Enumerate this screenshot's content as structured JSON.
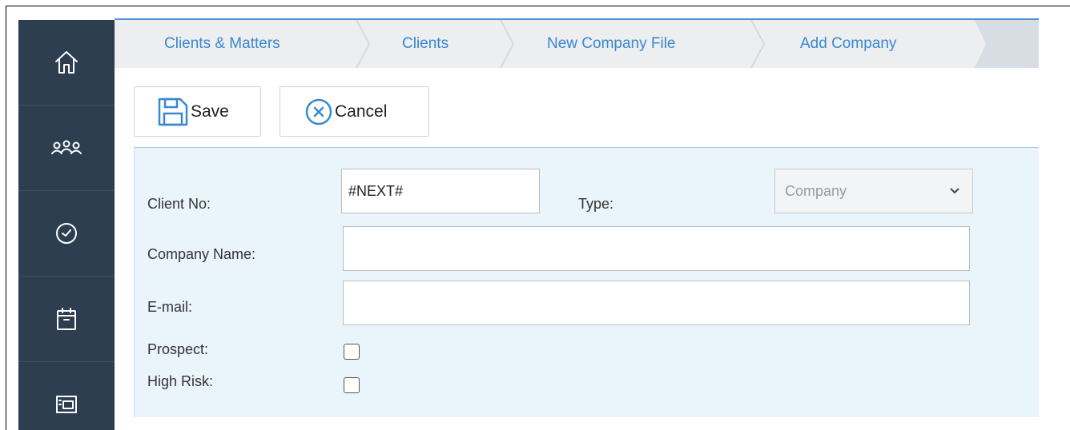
{
  "breadcrumb": {
    "items": [
      {
        "label": "Clients & Matters"
      },
      {
        "label": "Clients"
      },
      {
        "label": "New Company File"
      },
      {
        "label": "Add Company"
      }
    ]
  },
  "sidebar": {
    "items": [
      {
        "icon": "home-icon"
      },
      {
        "icon": "people-icon"
      },
      {
        "icon": "clock-icon"
      },
      {
        "icon": "calendar-icon"
      },
      {
        "icon": "document-icon"
      }
    ]
  },
  "toolbar": {
    "save_label": "Save",
    "save_icon": "floppy-disk-icon",
    "cancel_label": "Cancel",
    "cancel_icon": "close-circle-icon"
  },
  "form": {
    "client_no_label": "Client No:",
    "client_no_value": "#NEXT#",
    "type_label": "Type:",
    "type_value": "Company",
    "company_name_label": "Company Name:",
    "company_name_value": "",
    "email_label": "E-mail:",
    "email_value": "",
    "prospect_label": "Prospect:",
    "prospect_checked": false,
    "high_risk_label": "High Risk:",
    "high_risk_checked": false
  },
  "colors": {
    "sidebar": "#2c3e50",
    "accent": "#3a87d0",
    "form_background": "#eaf4fb"
  }
}
